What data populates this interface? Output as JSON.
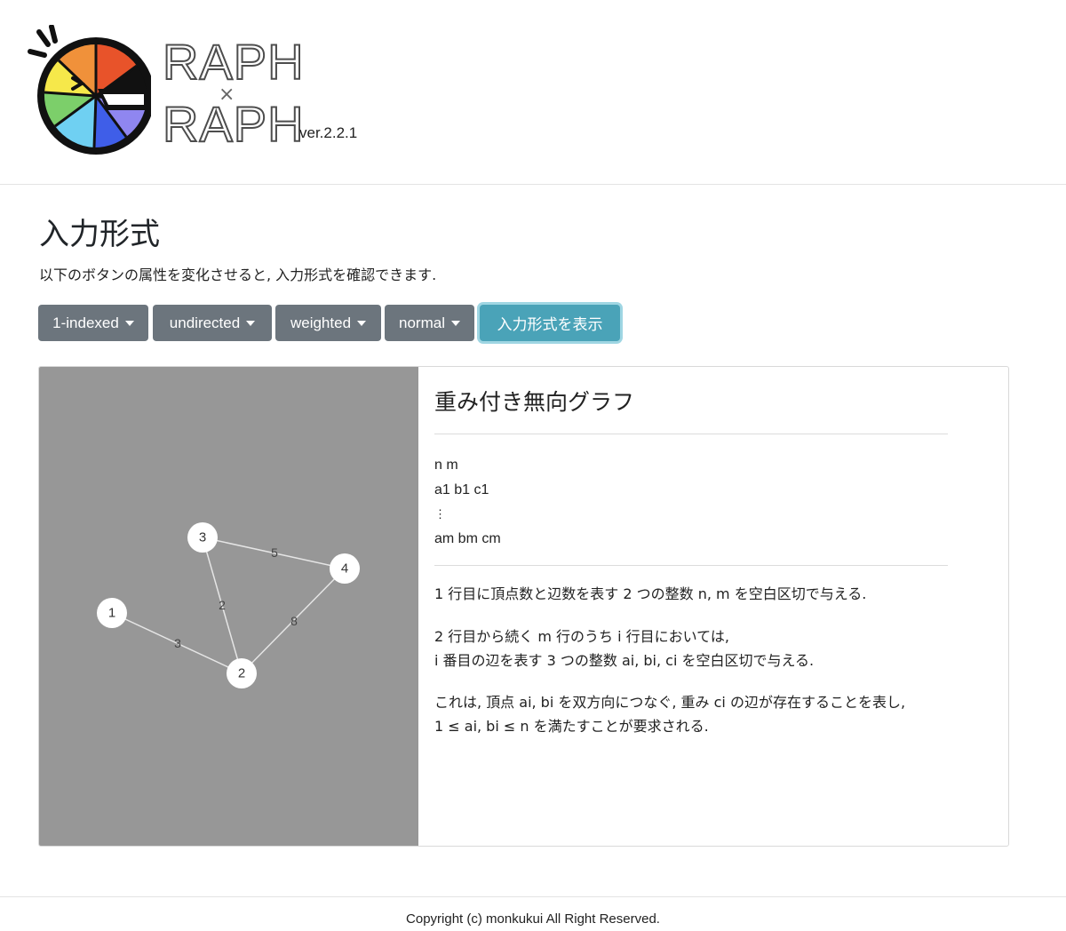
{
  "header": {
    "logo": {
      "text_top": "RAPH",
      "text_bottom": "RAPH",
      "text_mid": "×",
      "mascot_icon": "g-pie-logo"
    },
    "version": "ver.2.2.1"
  },
  "main": {
    "title": "入力形式",
    "subtitle": "以下のボタンの属性を変化させると, 入力形式を確認できます.",
    "toolbar": {
      "indexing": "1-indexed",
      "direction": "undirected",
      "weight": "weighted",
      "mode": "normal",
      "show_format": "入力形式を表示"
    },
    "graph": {
      "background": "#979797",
      "nodes": [
        "1",
        "2",
        "3",
        "4"
      ],
      "edges": [
        {
          "from": "1",
          "to": "2",
          "weight": "3"
        },
        {
          "from": "3",
          "to": "2",
          "weight": "2"
        },
        {
          "from": "3",
          "to": "4",
          "weight": "5"
        },
        {
          "from": "2",
          "to": "4",
          "weight": "8"
        }
      ]
    },
    "description": {
      "title": "重み付き無向グラフ",
      "format_lines": [
        "n m",
        "a1 b1 c1",
        "⋮",
        "am bm cm"
      ],
      "paragraph1": "1 行目に頂点数と辺数を表す 2 つの整数 n, m を空白区切で与える.",
      "paragraph2_line1": "2 行目から続く m 行のうち i 行目においては,",
      "paragraph2_line2": "i 番目の辺を表す 3 つの整数 ai, bi, ci を空白区切で与える.",
      "paragraph3_line1": "これは, 頂点 ai, bi を双方向につなぐ, 重み ci の辺が存在することを表し,",
      "paragraph3_line2": "1 ≤ ai, bi ≤ n を満たすことが要求される."
    }
  },
  "footer": {
    "copyright": "Copyright (c) monkukui All Right Reserved."
  },
  "colors": {
    "button_gray": "#6c757d",
    "button_info": "#4aa3b8"
  }
}
